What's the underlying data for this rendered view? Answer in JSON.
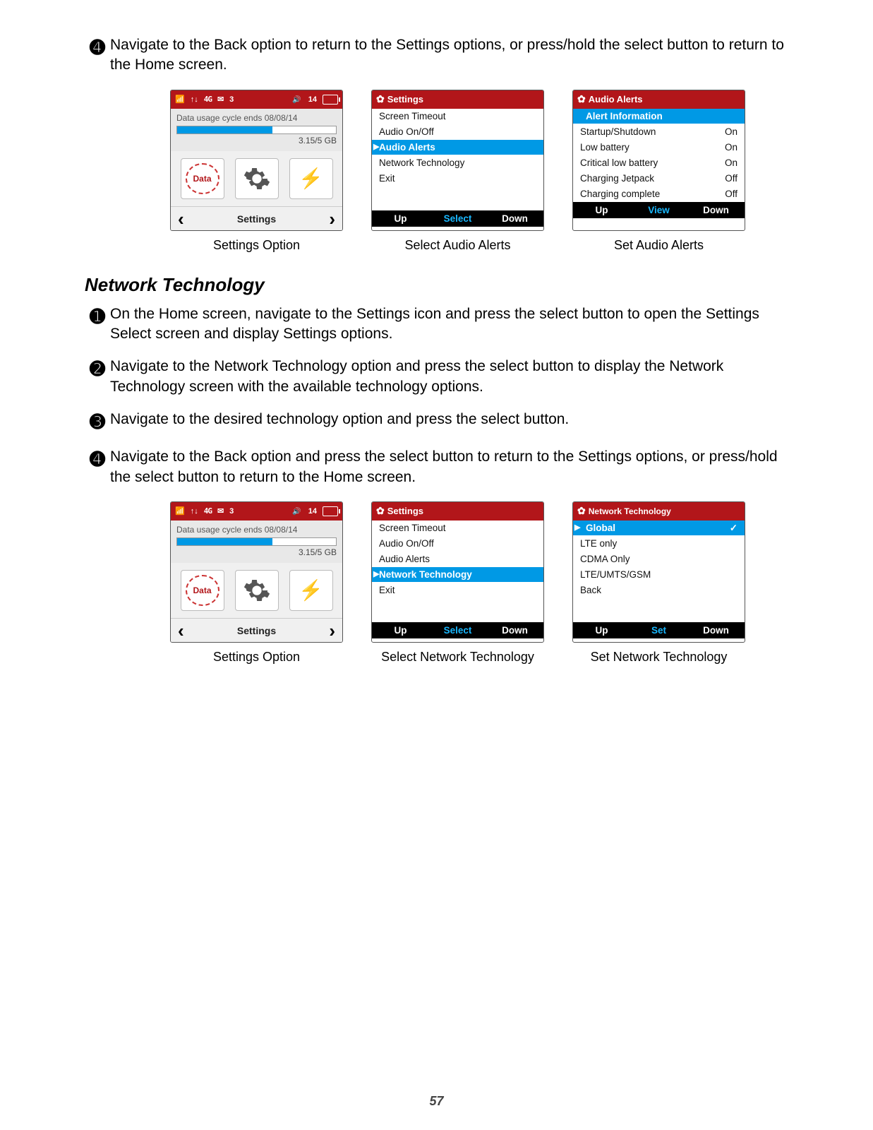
{
  "step4_top": "Navigate to the Back option to return to the Settings options, or press/hold the select button to return to the Home screen.",
  "nums": {
    "n1": "➊",
    "n2": "➋",
    "n3": "➌",
    "n4": "➍"
  },
  "fig1": {
    "caption_a": "Settings Option",
    "caption_b": "Select Audio Alerts",
    "caption_c": "Set Audio Alerts"
  },
  "home": {
    "status": {
      "lte": "4G",
      "msg": "3",
      "wifi": "14"
    },
    "usage_label": "Data usage cycle ends 08/08/14",
    "usage_used": "3.15/5 GB",
    "nav_label": "Settings",
    "data_icon": "Data"
  },
  "settings_menu1": {
    "title": "Settings",
    "items": {
      "a": "Screen Timeout",
      "b": "Audio On/Off",
      "c": "Audio Alerts",
      "d": "Network Technology",
      "e": "Exit"
    },
    "soft": {
      "l": "Up",
      "m": "Select",
      "r": "Down"
    }
  },
  "audio_alerts": {
    "title": "Audio Alerts",
    "head": "Alert Information",
    "rows": {
      "a": {
        "label": "Startup/Shutdown",
        "val": "On"
      },
      "b": {
        "label": "Low battery",
        "val": "On"
      },
      "c": {
        "label": "Critical low battery",
        "val": "On"
      },
      "d": {
        "label": "Charging Jetpack",
        "val": "Off"
      },
      "e": {
        "label": "Charging complete",
        "val": "Off"
      }
    },
    "soft": {
      "l": "Up",
      "m": "View",
      "r": "Down"
    }
  },
  "section_title": "Network Technology",
  "steps": {
    "s1": "On the Home screen, navigate to the Settings icon and press the select button to open the Settings Select screen and display Settings options.",
    "s2": "Navigate to the Network Technology option and press the select button to display the Network Technology screen with the available technology options.",
    "s3": "Navigate to the desired technology option and press the select button.",
    "s4": "Navigate to the Back option and press the select button to return to the Settings options, or press/hold the select button to return to the Home  screen."
  },
  "fig2": {
    "caption_a": "Settings Option",
    "caption_b": "Select Network Technology",
    "caption_c": "Set Network Technology"
  },
  "settings_menu2": {
    "title": "Settings",
    "items": {
      "a": "Screen Timeout",
      "b": "Audio On/Off",
      "c": "Audio Alerts",
      "d": "Network Technology",
      "e": "Exit"
    },
    "soft": {
      "l": "Up",
      "m": "Select",
      "r": "Down"
    }
  },
  "nettech": {
    "title": "Network Technology",
    "rows": {
      "a": "Global",
      "b": "LTE only",
      "c": "CDMA Only",
      "d": "LTE/UMTS/GSM",
      "e": "Back"
    },
    "check": "✓",
    "soft": {
      "l": "Up",
      "m": "Set",
      "r": "Down"
    }
  },
  "page_number": "57"
}
